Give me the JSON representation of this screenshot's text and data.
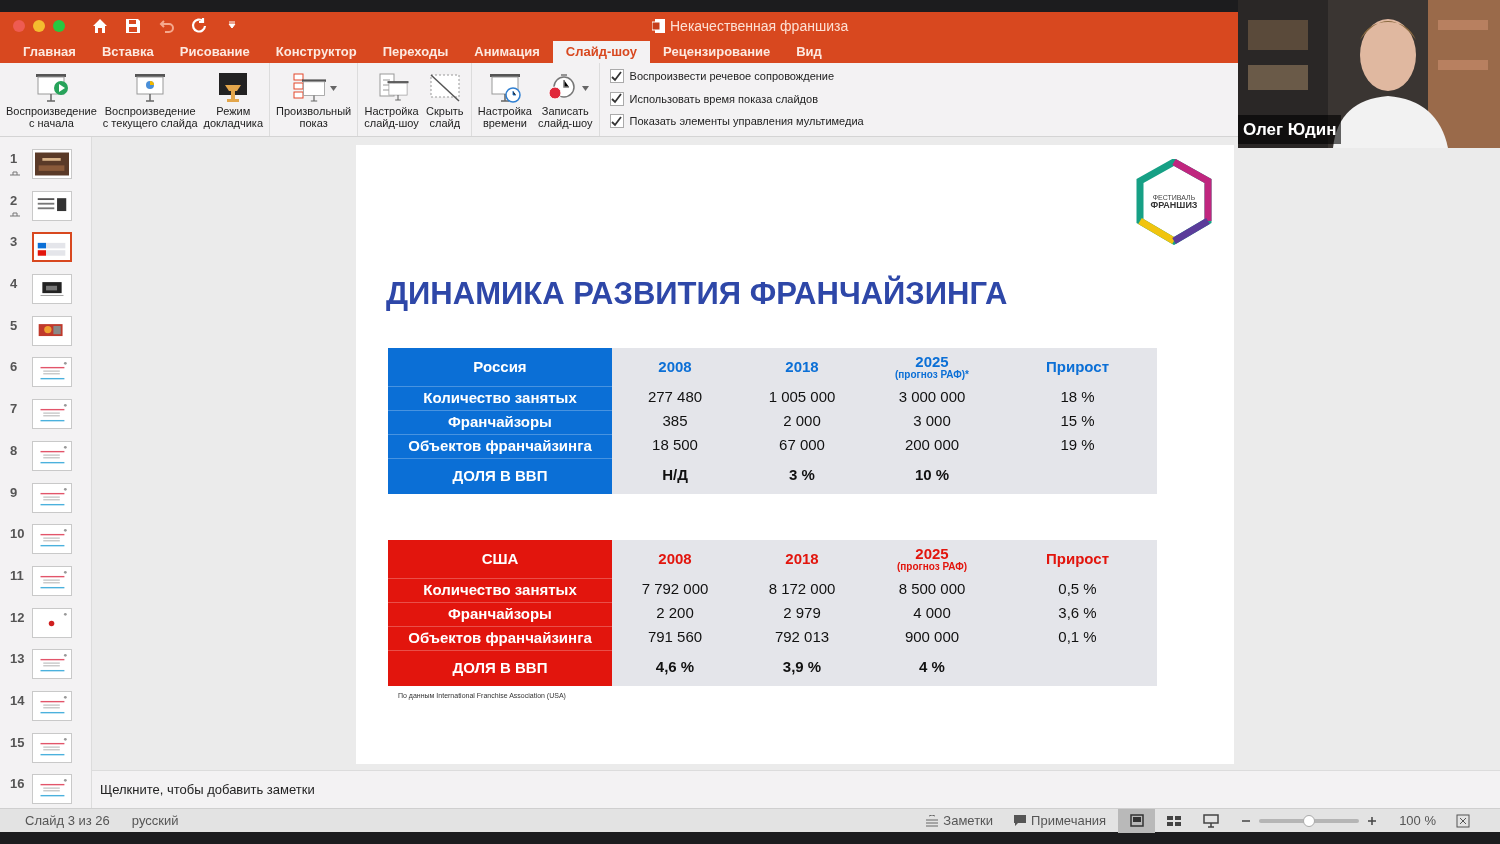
{
  "window": {
    "title": "Некачественная франшиза"
  },
  "quick_access": [
    {
      "kind": "home",
      "disabled": false
    },
    {
      "kind": "save",
      "disabled": false
    },
    {
      "kind": "undo",
      "disabled": true
    },
    {
      "kind": "redo",
      "disabled": false
    },
    {
      "kind": "customize",
      "disabled": false
    }
  ],
  "tabs": [
    {
      "label": "Главная",
      "selected": false
    },
    {
      "label": "Вставка",
      "selected": false
    },
    {
      "label": "Рисование",
      "selected": false
    },
    {
      "label": "Конструктор",
      "selected": false
    },
    {
      "label": "Переходы",
      "selected": false
    },
    {
      "label": "Анимация",
      "selected": false
    },
    {
      "label": "Слайд-шоу",
      "selected": true
    },
    {
      "label": "Рецензирование",
      "selected": false
    },
    {
      "label": "Вид",
      "selected": false
    }
  ],
  "ribbon": {
    "groups": [
      {
        "buttons": [
          {
            "kind": "play",
            "label": [
              "Воспроизведение",
              "с начала"
            ],
            "dropdown": false
          },
          {
            "kind": "current",
            "label": [
              "Воспроизведение",
              "с текущего слайда"
            ],
            "dropdown": false
          },
          {
            "kind": "presenter",
            "label": [
              "Режим",
              "докладчика"
            ],
            "dropdown": false
          }
        ]
      },
      {
        "buttons": [
          {
            "kind": "custom",
            "label": [
              "Произвольный",
              "показ"
            ],
            "dropdown": true
          }
        ]
      },
      {
        "buttons": [
          {
            "kind": "setup",
            "label": [
              "Настройка",
              "слайд-шоу"
            ],
            "dropdown": false
          },
          {
            "kind": "hide",
            "label": [
              "Скрыть",
              "слайд"
            ],
            "dropdown": false
          }
        ]
      },
      {
        "buttons": [
          {
            "kind": "timing",
            "label": [
              "Настройка",
              "времени"
            ],
            "dropdown": false
          },
          {
            "kind": "record",
            "label": [
              "Записать",
              "слайд-шоу"
            ],
            "dropdown": true
          }
        ]
      }
    ],
    "checkboxes": [
      {
        "label": "Воспроизвести речевое сопровождение",
        "checked": true
      },
      {
        "label": "Использовать время показа слайдов",
        "checked": true
      },
      {
        "label": "Показать элементы управления мультимедиа",
        "checked": true
      }
    ]
  },
  "thumbnails": [
    {
      "number": "1",
      "selected": false,
      "transition": true
    },
    {
      "number": "2",
      "kind": "text",
      "selected": false,
      "transition": true
    },
    {
      "number": "3",
      "kind": "table",
      "selected": true,
      "transition": false
    },
    {
      "number": "4",
      "kind": "dark",
      "selected": false,
      "transition": false
    },
    {
      "number": "5",
      "selected": false,
      "transition": false
    },
    {
      "number": "6",
      "kind": "lines",
      "selected": false,
      "transition": false
    },
    {
      "number": "7",
      "kind": "lines",
      "selected": false,
      "transition": false
    },
    {
      "number": "8",
      "kind": "lines",
      "selected": false,
      "transition": false
    },
    {
      "number": "9",
      "kind": "lines",
      "selected": false,
      "transition": false
    },
    {
      "number": "10",
      "kind": "lines",
      "selected": false,
      "transition": false
    },
    {
      "number": "11",
      "kind": "lines",
      "selected": false,
      "transition": false
    },
    {
      "number": "12",
      "kind": "dot",
      "selected": false,
      "transition": false
    },
    {
      "number": "13",
      "kind": "lines",
      "selected": false,
      "transition": false
    },
    {
      "number": "14",
      "kind": "lines",
      "selected": false,
      "transition": false
    },
    {
      "number": "15",
      "kind": "lines",
      "selected": false,
      "transition": false
    },
    {
      "number": "16",
      "kind": "lines",
      "selected": false,
      "transition": false
    }
  ],
  "slide": {
    "logo": [
      "ФЕСТИВАЛЬ",
      "ФРАНШИЗ"
    ],
    "title": "ДИНАМИКА РАЗВИТИЯ ФРАНЧАЙЗИНГА",
    "tables": [
      {
        "color": "#0b6fd6",
        "header": [
          {
            "text": "Россия"
          },
          {
            "text": "2008"
          },
          {
            "text": "2018"
          },
          {
            "text": "2025",
            "note": "(прогноз РАФ)*"
          },
          {
            "text": "Прирост"
          }
        ],
        "rows": [
          {
            "kind": "normal",
            "label": "Количество занятых",
            "values": [
              "277 480",
              "1 005 000",
              "3 000 000",
              "18 %"
            ]
          },
          {
            "kind": "normal",
            "label": "Франчайзоры",
            "values": [
              "385",
              "2 000",
              "3 000",
              "15 %"
            ]
          },
          {
            "kind": "normal",
            "label": "Объектов франчайзинга",
            "values": [
              "18 500",
              "67 000",
              "200 000",
              "19 %"
            ]
          },
          {
            "kind": "total",
            "label": "ДОЛЯ В ВВП",
            "values": [
              "Н/Д",
              "3 %",
              "10 %"
            ]
          }
        ]
      },
      {
        "color": "#e2150d",
        "header": [
          {
            "text": "США"
          },
          {
            "text": "2008"
          },
          {
            "text": "2018"
          },
          {
            "text": "2025",
            "note": "(прогноз РАФ)"
          },
          {
            "text": "Прирост"
          }
        ],
        "rows": [
          {
            "kind": "normal",
            "label": "Количество занятых",
            "values": [
              "7 792 000",
              "8 172 000",
              "8 500 000",
              "0,5 %"
            ]
          },
          {
            "kind": "normal",
            "label": "Франчайзоры",
            "values": [
              "2 200",
              "2 979",
              "4 000",
              "3,6 %"
            ]
          },
          {
            "kind": "normal",
            "label": "Объектов франчайзинга",
            "values": [
              "791 560",
              "792 013",
              "900 000",
              "0,1 %"
            ]
          },
          {
            "kind": "total",
            "label": "ДОЛЯ В ВВП",
            "values": [
              "4,6 %",
              "3,9 %",
              "4 %"
            ]
          }
        ]
      }
    ],
    "footnote": "По данным International Franchise Association (USA)"
  },
  "notes": {
    "placeholder": "Щелкните, чтобы добавить заметки"
  },
  "status_bar": {
    "slide_info": "Слайд 3 из 26",
    "language": "русский",
    "notes_button": "Заметки",
    "comments_button": "Примечания",
    "views": [
      {
        "kind": "normal",
        "selected": true
      },
      {
        "kind": "sorter",
        "selected": false
      },
      {
        "kind": "reading",
        "selected": false
      }
    ],
    "zoom": {
      "level": 0.5,
      "reading": "100 %"
    }
  },
  "video": {
    "name": "Олег Юдин"
  }
}
